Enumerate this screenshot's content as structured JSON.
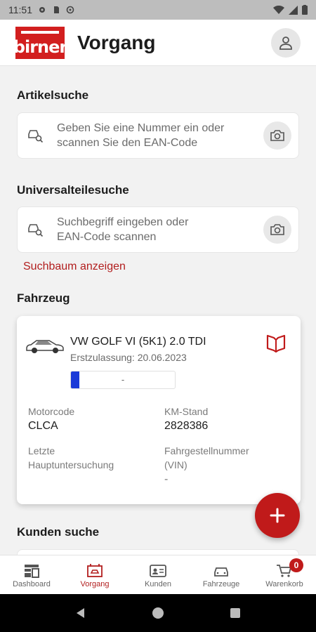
{
  "status_bar": {
    "time": "11:51"
  },
  "app_bar": {
    "logo_text": "birner",
    "title": "Vorgang"
  },
  "article_search": {
    "title": "Artikelsuche",
    "placeholder_line1": "Geben Sie eine Nummer ein oder",
    "placeholder_line2": "scannen Sie den EAN-Code"
  },
  "universal_search": {
    "title": "Universalteilesuche",
    "placeholder_line1": "Suchbegriff eingeben oder",
    "placeholder_line2": "EAN-Code scannen",
    "tree_link": "Suchbaum anzeigen"
  },
  "vehicle": {
    "section_title": "Fahrzeug",
    "name": "VW GOLF VI (5K1) 2.0 TDI",
    "registration": "Erstzulassung: 20.06.2023",
    "progress_text": "-",
    "progress_fraction": 0.08,
    "motorcode_label": "Motorcode",
    "motorcode_value": "CLCA",
    "km_label": "KM-Stand",
    "km_value": "2828386",
    "inspection_label_line1": "Letzte",
    "inspection_label_line2": "Hauptuntersuchung",
    "vin_label_line1": "Fahrgestellnummer",
    "vin_label_line2": "(VIN)",
    "vin_value": "-"
  },
  "customer_search": {
    "title": "Kunden suche"
  },
  "bottom_nav": {
    "dashboard": "Dashboard",
    "vorgang": "Vorgang",
    "kunden": "Kunden",
    "fahrzeuge": "Fahrzeuge",
    "warenkorb": "Warenkorb",
    "cart_count": "0"
  },
  "colors": {
    "accent": "#c01a1a",
    "progress": "#1a3ad8"
  }
}
